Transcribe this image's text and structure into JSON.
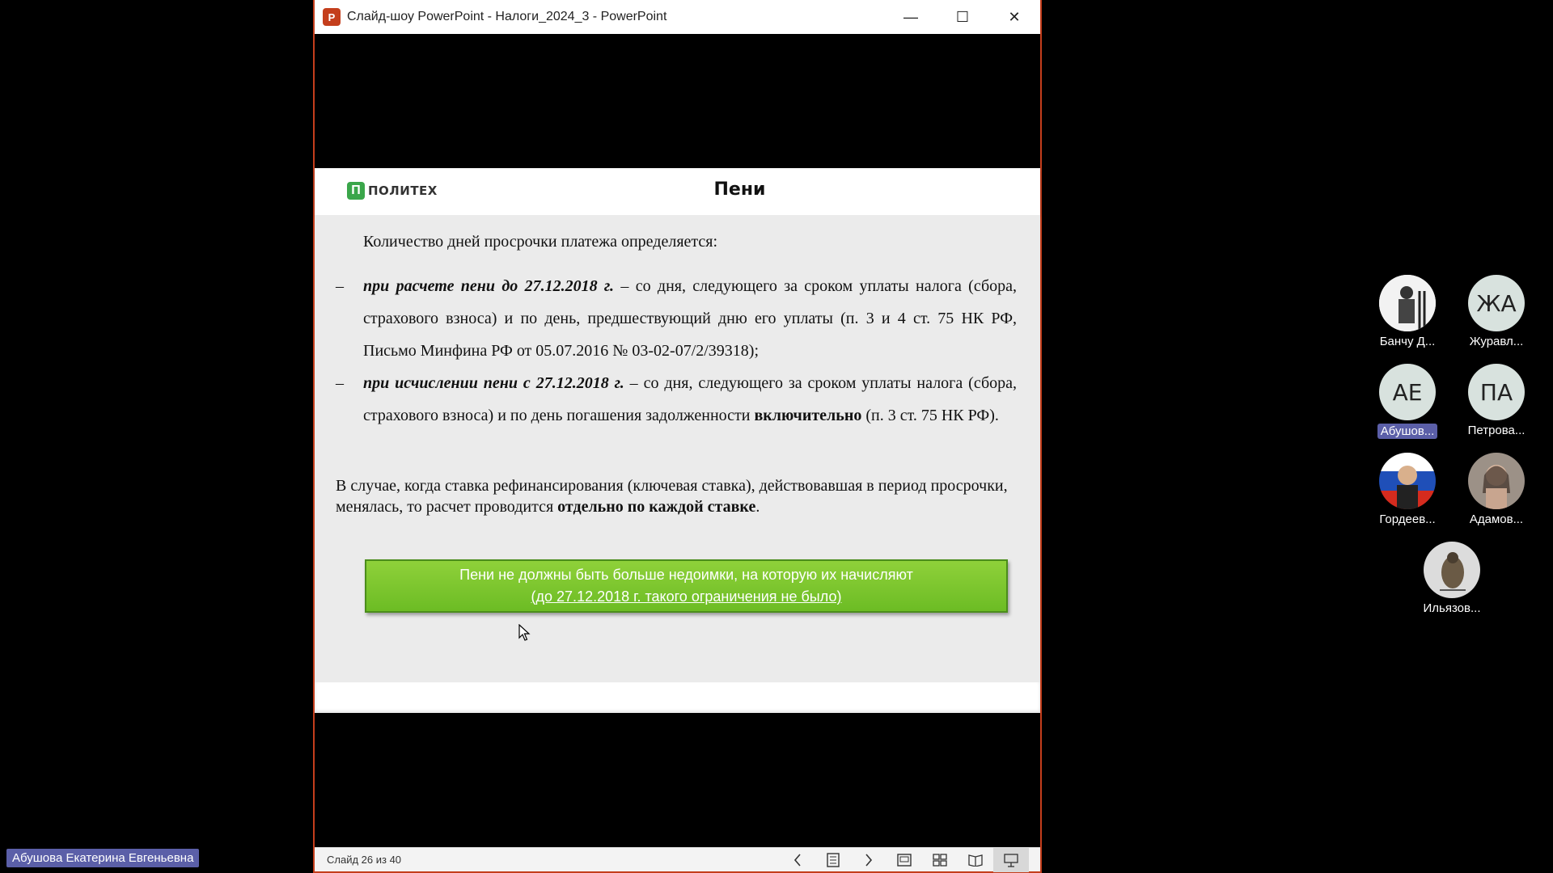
{
  "window": {
    "title": "Слайд-шоу PowerPoint  -  Налоги_2024_3 - PowerPoint",
    "app_icon": "P",
    "minimize": "—",
    "maximize": "☐",
    "close": "✕",
    "accent_color": "#c43e1c"
  },
  "slide": {
    "logo_mark": "П",
    "logo_text": "ПОЛИТЕХ",
    "title": "Пени",
    "intro": "Количество дней просрочки платежа определяется:",
    "bullets": [
      {
        "dash": "–",
        "lead": "при расчете пени до 27.12.2018 г.",
        "text": " – со дня, следующего за сроком уплаты налога (сбора, страхового взноса) и по день, предшествующий дню его уплаты (п. 3 и 4 ст. 75 НК РФ, Письмо Минфина РФ от 05.07.2016 № 03-02-07/2/39318);"
      },
      {
        "dash": "–",
        "lead": "при исчислении пени с 27.12.2018 г.",
        "text_a": " – со дня, следующего за сроком уплаты налога (сбора, страхового взноса) и по день погашения задолженности ",
        "bold": "включительно",
        "text_b": " (п. 3 ст. 75 НК РФ)."
      }
    ],
    "paragraph_a": "В случае, когда ставка рефинансирования (ключевая ставка), действовавшая в период просрочки, менялась, то расчет проводится ",
    "paragraph_bold": "отдельно по каждой ставке",
    "paragraph_b": ".",
    "callout_line1": "Пени не должны быть больше недоимки, на которую их начисляют",
    "callout_line2": "(до 27.12.2018 г. такого ограничения не было)",
    "callout_color": "#7cc52e"
  },
  "statusbar": {
    "slide_counter": "Слайд 26 из 40",
    "icons": [
      "chevron-left-icon",
      "slide-list-icon",
      "chevron-right-icon",
      "normal-view-icon",
      "slide-sorter-icon",
      "reading-view-icon",
      "slideshow-icon"
    ]
  },
  "participants": [
    {
      "name": "Банчу Д...",
      "type": "photo"
    },
    {
      "name": "Журавл...",
      "initials": "ЖА"
    },
    {
      "name": "Абушов...",
      "initials": "АЕ",
      "highlighted": true
    },
    {
      "name": "Петрова...",
      "initials": "ПА"
    },
    {
      "name": "Гордеев...",
      "type": "photo"
    },
    {
      "name": "Адамов...",
      "type": "photo"
    },
    {
      "name": "Ильязов...",
      "type": "photo"
    }
  ],
  "speaker": "Абушова Екатерина Евгеньевна"
}
